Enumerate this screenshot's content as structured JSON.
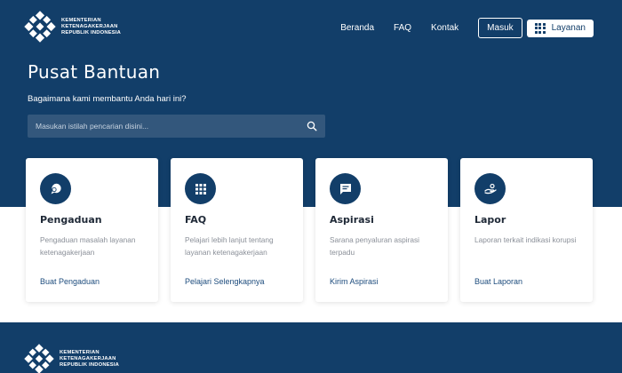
{
  "brand": {
    "line1": "KEMENTERIAN",
    "line2": "KETENAGAKERJAAN",
    "line3": "REPUBLIK INDONESIA",
    "icon": "kemnaker-logo-icon"
  },
  "nav": {
    "beranda": "Beranda",
    "faq": "FAQ",
    "kontak": "Kontak",
    "masuk": "Masuk",
    "layanan": "Layanan"
  },
  "hero": {
    "title": "Pusat Bantuan",
    "subtitle": "Bagaimana kami membantu Anda hari ini?"
  },
  "search": {
    "placeholder": "Masukan istilah pencarian disini..."
  },
  "cards": [
    {
      "title": "Pengaduan",
      "desc": "Pengaduan masalah layanan ketenagakerjaan",
      "link": "Buat Pengaduan",
      "icon": "chat-bubble-icon"
    },
    {
      "title": "FAQ",
      "desc": "Pelajari lebih lanjut tentang layanan ketenagakerjaan",
      "link": "Pelajari Selengkapnya",
      "icon": "grid-icon"
    },
    {
      "title": "Aspirasi",
      "desc": "Sarana penyaluran aspirasi terpadu",
      "link": "Kirim Aspirasi",
      "icon": "message-icon"
    },
    {
      "title": "Lapor",
      "desc": "Laporan terkait indikasi korupsi",
      "link": "Buat Laporan",
      "icon": "report-hand-icon"
    }
  ],
  "colors": {
    "navy": "#123e69",
    "searchBg": "#33577c",
    "link": "#1d4c7d"
  }
}
